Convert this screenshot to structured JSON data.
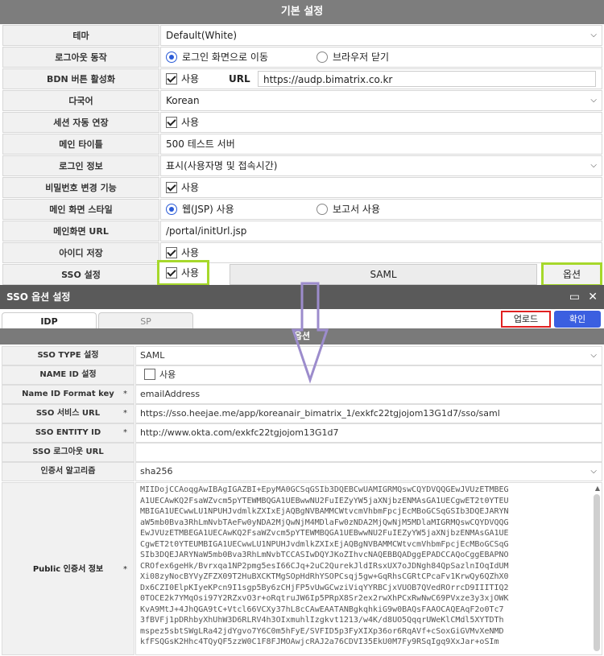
{
  "panel": {
    "title": "기본 설정",
    "theme": {
      "label": "테마",
      "value": "Default(White)"
    },
    "logout": {
      "label": "로그아웃 동작",
      "option1": "로그인 화면으로 이동",
      "option2": "브라우저 닫기"
    },
    "bdn": {
      "label": "BDN 버튼 활성화",
      "check": "사용",
      "url_label": "URL",
      "url_value": "https://audp.bimatrix.co.kr"
    },
    "lang": {
      "label": "다국어",
      "value": "Korean"
    },
    "session": {
      "label": "세션 자동 연장",
      "check": "사용"
    },
    "main_title": {
      "label": "메인 타이틀",
      "value": "500 테스트 서버"
    },
    "login_info": {
      "label": "로그인 정보",
      "value": "표시(사용자명 및 접속시간)"
    },
    "pw_change": {
      "label": "비밀번호 변경 기능",
      "check": "사용"
    },
    "main_style": {
      "label": "메인 화면 스타일",
      "option1": "웹(JSP) 사용",
      "option2": "보고서 사용"
    },
    "main_url": {
      "label": "메인화면 URL",
      "value": "/portal/initUrl.jsp"
    },
    "id_save": {
      "label": "아이디 저장",
      "check": "사용"
    },
    "sso": {
      "label": "SSO 설정",
      "check": "사용",
      "saml_btn": "SAML",
      "option_btn": "옵션"
    }
  },
  "dialog": {
    "title": "SSO 옵션 설정",
    "tab_idp": "IDP",
    "tab_sp": "SP",
    "upload_btn": "업로드",
    "ok_btn": "확인",
    "section": "옵션",
    "rows": {
      "sso_type": {
        "label": "SSO TYPE 설정",
        "value": "SAML"
      },
      "name_id": {
        "label": "NAME ID 설정",
        "check": "사용"
      },
      "name_id_format": {
        "label": "Name ID Format key",
        "value": "emailAddress"
      },
      "sso_url": {
        "label": "SSO 서비스 URL",
        "value": "https://sso.heejae.me/app/koreanair_bimatrix_1/exkfc22tgjojom13G1d7/sso/saml"
      },
      "entity_id": {
        "label": "SSO ENTITY ID",
        "value": "http://www.okta.com/exkfc22tgjojom13G1d7"
      },
      "logout_url": {
        "label": "SSO 로그아웃 URL",
        "value": ""
      },
      "cert_alg": {
        "label": "인증서 알고리즘",
        "value": "sha256"
      },
      "public_cert": {
        "label": "Public 인증서 정보"
      }
    },
    "required_mark": "*",
    "cert_text": "MIIDojCCAoqgAwIBAgIGAZBI+EpyMA0GCSqGSIb3DQEBCwUAMIGRMQswCQYDVQQGEwJVUzETMBEG\nA1UECAwKQ2FsaWZvcm5pYTEWMBQGA1UEBwwNU2FuIEZyYW5jaXNjbzENMAsGA1UECgwET2t0YTEU\nMBIGA1UECwwLU1NPUHJvdmlkZXIxEjAQBgNVBAMMCWtvcmVhbmFpcjEcMBoGCSqGSIb3DQEJARYN\naW5mb0Bva3RhLmNvbTAeFw0yNDA2MjQwNjM4MDlaFw0zNDA2MjQwNjM5MDlaMIGRMQswCQYDVQQG\nEwJVUzETMBEGA1UECAwKQ2FsaWZvcm5pYTEWMBQGA1UEBwwNU2FuIEZyYW5jaXNjbzENMAsGA1UE\nCgwET2t0YTEUMBIGA1UECwwLU1NPUHJvdmlkZXIxEjAQBgNVBAMMCWtvcmVhbmFpcjEcMBoGCSqG\nSIb3DQEJARYNaW5mb0Bva3RhLmNvbTCCASIwDQYJKoZIhvcNAQEBBQADggEPADCCAQoCggEBAPNO\nCROfex6geHk/Bvrxqa1NP2pmg5esI66CJq+2uC2QurekJldIRsxUX7oJDNgh84QpSazlnIOqIdUM\nXi08zyNocBYVyZFZX09T2HuBXCKTMgSOpHdRhYSOPCsqj5gw+GqRhsCGRtCPcaFv1KrwQy6QZhX0\nDx6CZI0ElpKIyeKPcn9I1sgp5By6zCHjFP5vUwGCwziViqYYRBCjxVUOB7QVedROrrcD9IIITIQ2\n0TOCE2k7YMqOsi97Y2RZxvO3r+oRqtruJW6Ip5PRpX8Sr2ex2rwXhPCxRwNwC69PVxze3y3xjOWK\nKvA9MtJ+4JhQGA9tC+Vtcl66VCXy37hL8cCAwEAATANBgkqhkiG9w0BAQsFAAOCAQEAqF2o0Tc7\n3fBVFj1pDRhbyXhUhW3D6RLRV4h3OIxmuhlIzgkvt1213/w4K/d8UO5QqqrUWeKlCMdl5XYTDTh\nmspez5sbtSWgLRa42jdYgvo7Y6C0m5hFyE/SVFID5p3FyXIXp36or6RqAVf+cSoxGiGVMvXeNMD\nkfFSQGsK2Hhc4TQyQF5zzW0C1F8FJMOAwjcRAJ2a76CDVI35EkU0M7Fy9RSqIgq9XxJar+oSIm"
  }
}
